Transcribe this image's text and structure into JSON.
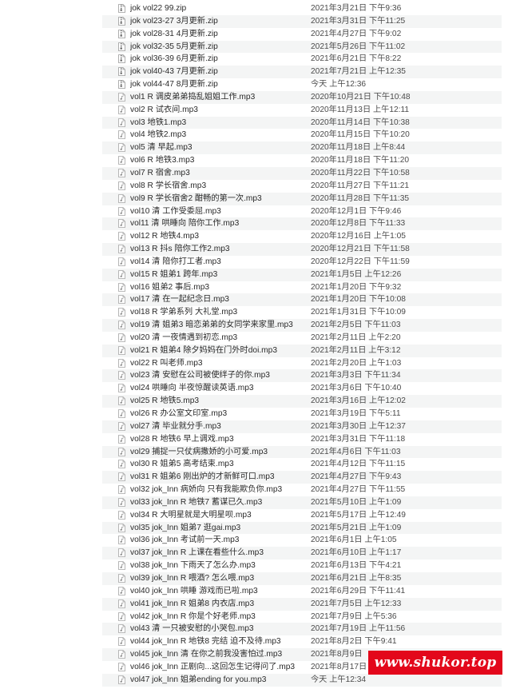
{
  "files": [
    {
      "name": "jok vol22 99.zip",
      "date": "2021年3月21日 下午9:36",
      "icon": "zip-archive-icon"
    },
    {
      "name": "jok vol23-27 3月更新.zip",
      "date": "2021年3月31日 下午11:25",
      "icon": "zip-archive-icon"
    },
    {
      "name": "jok vol28-31 4月更新.zip",
      "date": "2021年4月27日 下午9:02",
      "icon": "zip-archive-icon"
    },
    {
      "name": "jok vol32-35 5月更新.zip",
      "date": "2021年5月26日 下午11:02",
      "icon": "zip-archive-icon"
    },
    {
      "name": "jok vol36-39 6月更新.zip",
      "date": "2021年6月21日 下午8:22",
      "icon": "zip-archive-icon"
    },
    {
      "name": "jok vol40-43 7月更新.zip",
      "date": "2021年7月21日 上午12:35",
      "icon": "zip-archive-icon"
    },
    {
      "name": "jok vol44-47 8月更新.zip",
      "date": "今天 上午12:36",
      "icon": "zip-archive-icon"
    },
    {
      "name": "vol1 R 调皮弟弟捣乱姐姐工作.mp3",
      "date": "2020年10月21日 下午10:48",
      "icon": "audio-file-icon"
    },
    {
      "name": "vol2 R 试衣间.mp3",
      "date": "2020年11月13日 上午12:11",
      "icon": "audio-file-icon"
    },
    {
      "name": "vol3 地铁1.mp3",
      "date": "2020年11月14日 下午10:38",
      "icon": "audio-file-icon"
    },
    {
      "name": "vol4 地铁2.mp3",
      "date": "2020年11月15日 下午10:20",
      "icon": "audio-file-icon"
    },
    {
      "name": "vol5 清 早起.mp3",
      "date": "2020年11月18日 上午8:44",
      "icon": "audio-file-icon"
    },
    {
      "name": "vol6 R 地铁3.mp3",
      "date": "2020年11月18日 下午11:20",
      "icon": "audio-file-icon"
    },
    {
      "name": "vol7 R 宿舍.mp3",
      "date": "2020年11月22日 下午10:58",
      "icon": "audio-file-icon"
    },
    {
      "name": "vol8 R 学长宿舍.mp3",
      "date": "2020年11月27日 下午11:21",
      "icon": "audio-file-icon"
    },
    {
      "name": "vol9 R 学长宿舍2 酣畅的第一次.mp3",
      "date": "2020年11月28日 下午11:35",
      "icon": "audio-file-icon"
    },
    {
      "name": "vol10 清 工作受委屈.mp3",
      "date": "2020年12月1日 下午9:46",
      "icon": "audio-file-icon"
    },
    {
      "name": "vol11 清 哄睡向 陪你工作.mp3",
      "date": "2020年12月8日 下午11:33",
      "icon": "audio-file-icon"
    },
    {
      "name": "vol12 R 地铁4.mp3",
      "date": "2020年12月16日 上午1:05",
      "icon": "audio-file-icon"
    },
    {
      "name": "vol13 R 抖s 陪你工作2.mp3",
      "date": "2020年12月21日 下午11:58",
      "icon": "audio-file-icon"
    },
    {
      "name": "vol14 清 陪你打工者.mp3",
      "date": "2020年12月22日 下午11:59",
      "icon": "audio-file-icon"
    },
    {
      "name": "vol15 R 姐弟1 跨年.mp3",
      "date": "2021年1月5日 上午12:26",
      "icon": "audio-file-icon"
    },
    {
      "name": "vol16 姐弟2 事后.mp3",
      "date": "2021年1月20日 下午9:32",
      "icon": "audio-file-icon"
    },
    {
      "name": "vol17 清 在一起纪念日.mp3",
      "date": "2021年1月20日 下午10:08",
      "icon": "audio-file-icon"
    },
    {
      "name": "vol18 R 学弟系列 大礼堂.mp3",
      "date": "2021年1月31日 下午10:09",
      "icon": "audio-file-icon"
    },
    {
      "name": "vol19 清 姐弟3 暗恋弟弟的女同学来家里.mp3",
      "date": "2021年2月5日 下午11:03",
      "icon": "audio-file-icon"
    },
    {
      "name": "vol20 清 一夜情遇到初恋.mp3",
      "date": "2021年2月11日 上午2:20",
      "icon": "audio-file-icon"
    },
    {
      "name": "vol21 R 姐弟4 除夕妈妈在门外时doi.mp3",
      "date": "2021年2月11日 上午3:12",
      "icon": "audio-file-icon"
    },
    {
      "name": "vol22 R 叫老师.mp3",
      "date": "2021年2月20日 上午1:03",
      "icon": "audio-file-icon"
    },
    {
      "name": "vol23 清 安慰在公司被使绊子的你.mp3",
      "date": "2021年3月3日 下午11:34",
      "icon": "audio-file-icon"
    },
    {
      "name": "vol24 哄睡向 半夜惊醒读英语.mp3",
      "date": "2021年3月6日 下午10:40",
      "icon": "audio-file-icon"
    },
    {
      "name": "vol25 R 地铁5.mp3",
      "date": "2021年3月16日 上午12:02",
      "icon": "audio-file-icon"
    },
    {
      "name": "vol26 R 办公室文印室.mp3",
      "date": "2021年3月19日 下午5:11",
      "icon": "audio-file-icon"
    },
    {
      "name": "vol27 清 毕业就分手.mp3",
      "date": "2021年3月30日 上午12:37",
      "icon": "audio-file-icon"
    },
    {
      "name": "vol28 R 地铁6 早上调戏.mp3",
      "date": "2021年3月31日 下午11:18",
      "icon": "audio-file-icon"
    },
    {
      "name": "vol29 捕捉一只仗病撒娇的小可爱.mp3",
      "date": "2021年4月6日 下午11:03",
      "icon": "audio-file-icon"
    },
    {
      "name": "vol30 R 姐弟5 高考结束.mp3",
      "date": "2021年4月12日 下午11:15",
      "icon": "audio-file-icon"
    },
    {
      "name": "vol31 R 姐弟6 刚出炉的才新鲜可口.mp3",
      "date": "2021年4月27日 下午9:43",
      "icon": "audio-file-icon"
    },
    {
      "name": "vol32 jok_Inn 病娇向 只有我能欺负你.mp3",
      "date": "2021年4月27日 下午11:55",
      "icon": "audio-file-icon"
    },
    {
      "name": "vol33 jok_Inn R 地铁7 蓄谋已久.mp3",
      "date": "2021年5月10日 上午1:09",
      "icon": "audio-file-icon"
    },
    {
      "name": "vol34 R 大明星就是大明星呗.mp3",
      "date": "2021年5月17日 上午12:49",
      "icon": "audio-file-icon"
    },
    {
      "name": "vol35 jok_Inn 姐弟7 逛gai.mp3",
      "date": "2021年5月21日 上午1:09",
      "icon": "audio-file-icon"
    },
    {
      "name": "vol36 jok_Inn 考试前一天.mp3",
      "date": "2021年6月1日 上午1:05",
      "icon": "audio-file-icon"
    },
    {
      "name": "vol37 jok_Inn R 上课在看些什么.mp3",
      "date": "2021年6月10日 上午1:17",
      "icon": "audio-file-icon"
    },
    {
      "name": "vol38 jok_Inn 下雨天了怎么办.mp3",
      "date": "2021年6月13日 下午4:21",
      "icon": "audio-file-icon"
    },
    {
      "name": "vol39 jok_Inn R 喂酒? 怎么喂.mp3",
      "date": "2021年6月21日 上午8:35",
      "icon": "audio-file-icon"
    },
    {
      "name": "vol40 jok_Inn 哄睡 游戏而已啦.mp3",
      "date": "2021年6月29日 下午11:41",
      "icon": "audio-file-icon"
    },
    {
      "name": "vol41 jok_Inn R 姐弟8 内衣店.mp3",
      "date": "2021年7月5日 上午12:33",
      "icon": "audio-file-icon"
    },
    {
      "name": "vol42 jok_Inn R 你是个好老师.mp3",
      "date": "2021年7月9日 上午5:36",
      "icon": "audio-file-icon"
    },
    {
      "name": "vol43 清 一只被安慰的小哭包.mp3",
      "date": "2021年7月19日 上午11:56",
      "icon": "audio-file-icon"
    },
    {
      "name": "vol44 jok_Inn R 地铁8 完结 迫不及待.mp3",
      "date": "2021年8月2日 下午9:41",
      "icon": "audio-file-icon"
    },
    {
      "name": "vol45 jok_Inn 清 在你之前我没害怕过.mp3",
      "date": "2021年8月9日",
      "icon": "audio-file-icon"
    },
    {
      "name": "vol46 jok_Inn 正剧向...这回怎生记得问了.mp3",
      "date": "2021年8月17日",
      "icon": "audio-file-icon"
    },
    {
      "name": "vol47 jok_Inn 姐弟ending for you.mp3",
      "date": "今天 上午12:34",
      "icon": "audio-file-icon"
    }
  ],
  "watermark": {
    "text": "www.shukor.top",
    "color": "#e3071b"
  }
}
